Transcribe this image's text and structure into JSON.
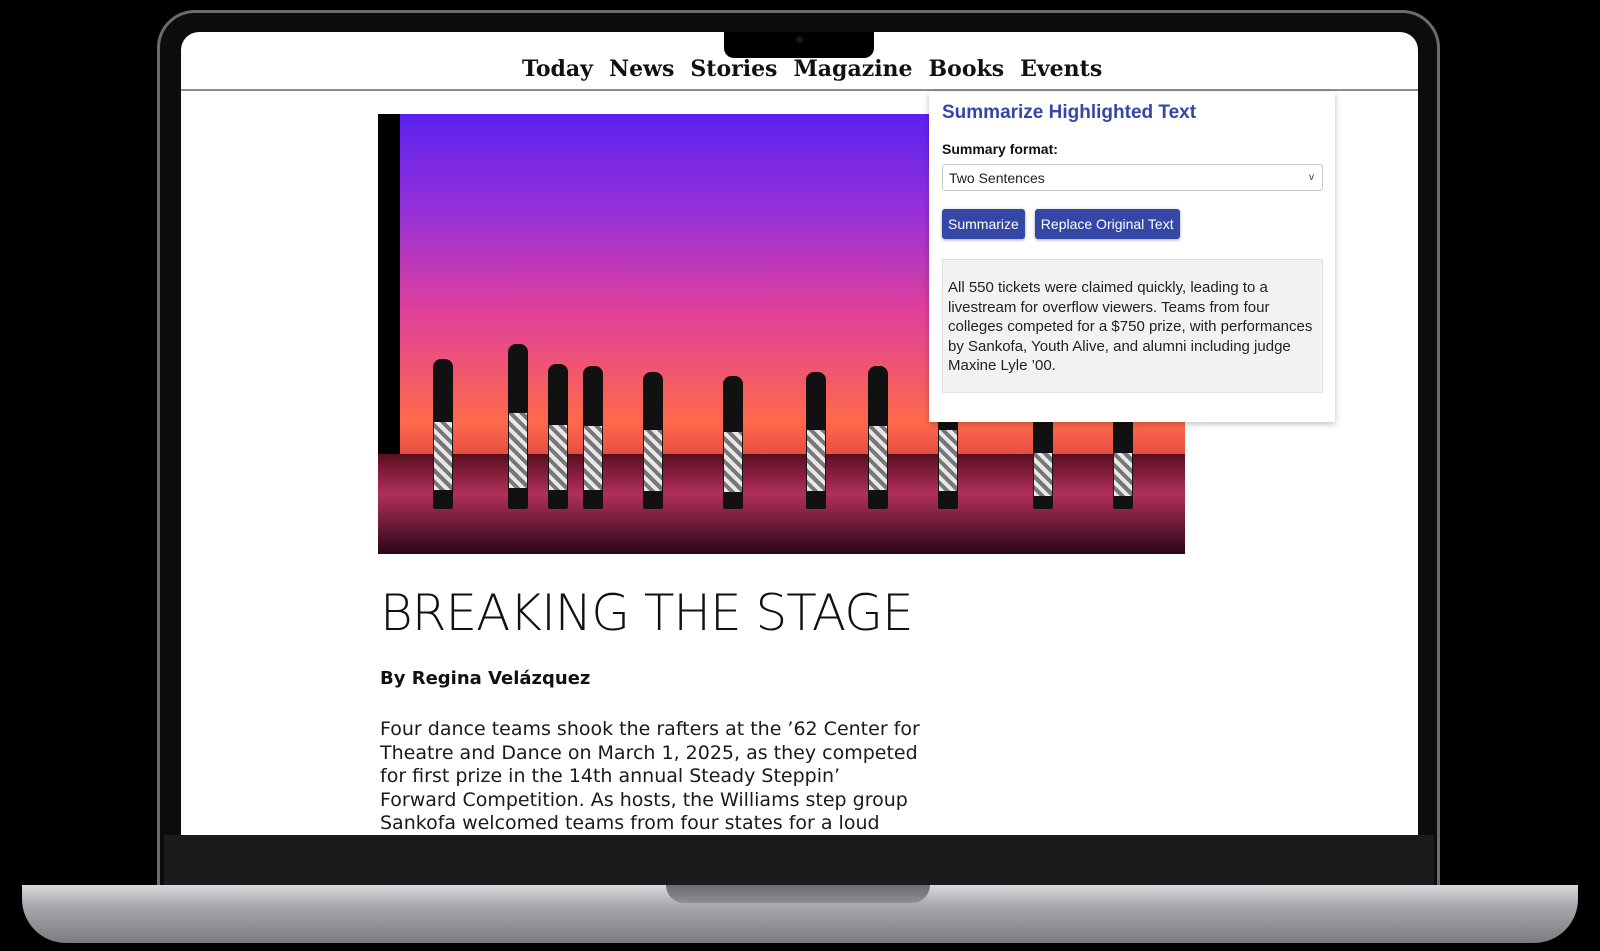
{
  "nav": {
    "items": [
      "Today",
      "News",
      "Stories",
      "Magazine",
      "Books",
      "Events"
    ]
  },
  "article": {
    "title": "BREAKING THE STAGE",
    "byline": "By Regina Velázquez",
    "body": "Four dance teams shook the rafters at the ’62 Center for Theatre and Dance on March 1, 2025, as they competed for first prize in the 14th annual Steady Steppin’ Forward Competition. As hosts, the Williams step group Sankofa welcomed teams from four states for a loud and spirited"
  },
  "panel": {
    "title": "Summarize Highlighted Text",
    "format_label": "Summary format:",
    "format_value": "Two Sentences",
    "summarize_label": "Summarize",
    "replace_label": "Replace Original Text",
    "summary": "All 550 tickets were claimed quickly, leading to a livestream for overflow viewers. Teams from four colleges competed for a $750 prize, with performances by Sankofa, Youth Alive, and alumni including judge Maxine Lyle ’00."
  },
  "colors": {
    "accent": "#3446a6"
  },
  "icons": {
    "select_chevron": "chevron-down-icon"
  }
}
